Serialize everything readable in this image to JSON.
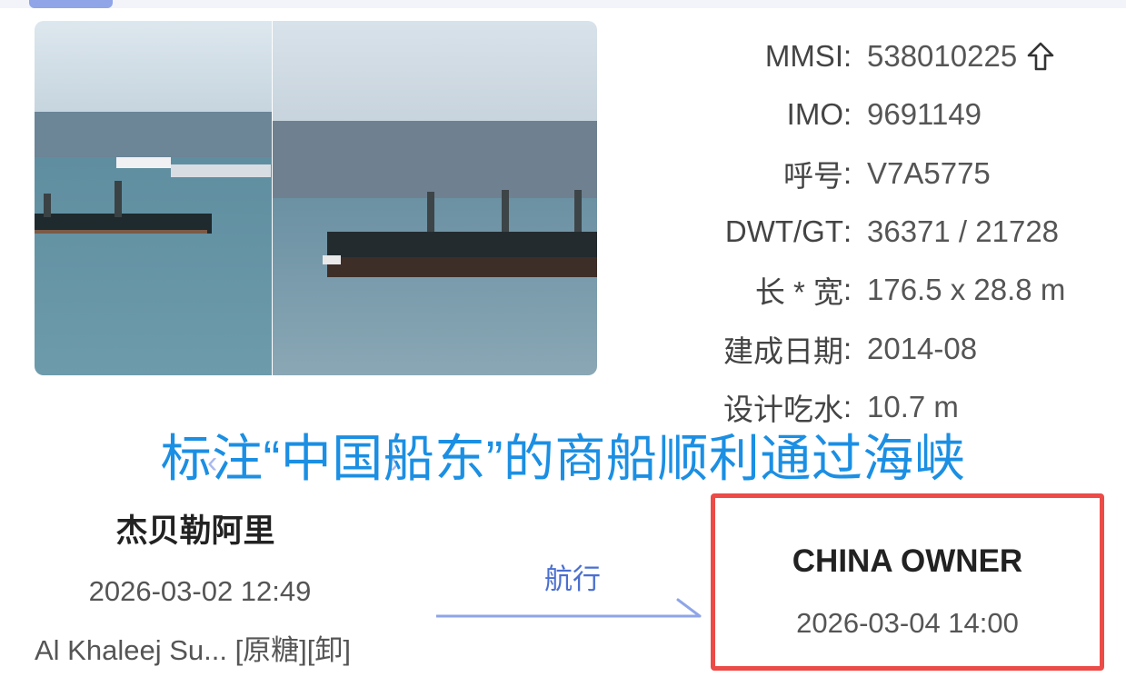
{
  "info": {
    "rows": [
      {
        "label": "MMSI",
        "colon": ":",
        "value": "538010225"
      },
      {
        "label": "IMO",
        "colon": ":",
        "value": "9691149"
      },
      {
        "label": "呼号",
        "colon": ":",
        "value": "V7A5775"
      },
      {
        "label": "DWT/GT",
        "colon": ":",
        "value": "36371 / 21728"
      },
      {
        "label": "长 * 宽",
        "colon": ":",
        "value": "176.5 x 28.8 m"
      },
      {
        "label": "建成日期",
        "colon": ":",
        "value": "2014-08"
      },
      {
        "label": "设计吃水",
        "colon": ":",
        "value": "10.7 m"
      }
    ],
    "mmsi_icon": "share-up-arrow-icon"
  },
  "headline": "标注“中国船东”的商船顺利通过海峡",
  "voyage": {
    "origin": {
      "name": "杰贝勒阿里",
      "time": "2026-03-02 12:49",
      "port": "Al Khaleej Su... [原糖][卸]"
    },
    "status_label": "航行",
    "destination": {
      "name": "CHINA OWNER",
      "time": "2026-03-04 14:00"
    }
  },
  "colors": {
    "accent_blue": "#1b8fe3",
    "highlight_red": "#ec4b47",
    "arrow_blue": "#8fa5e8"
  }
}
